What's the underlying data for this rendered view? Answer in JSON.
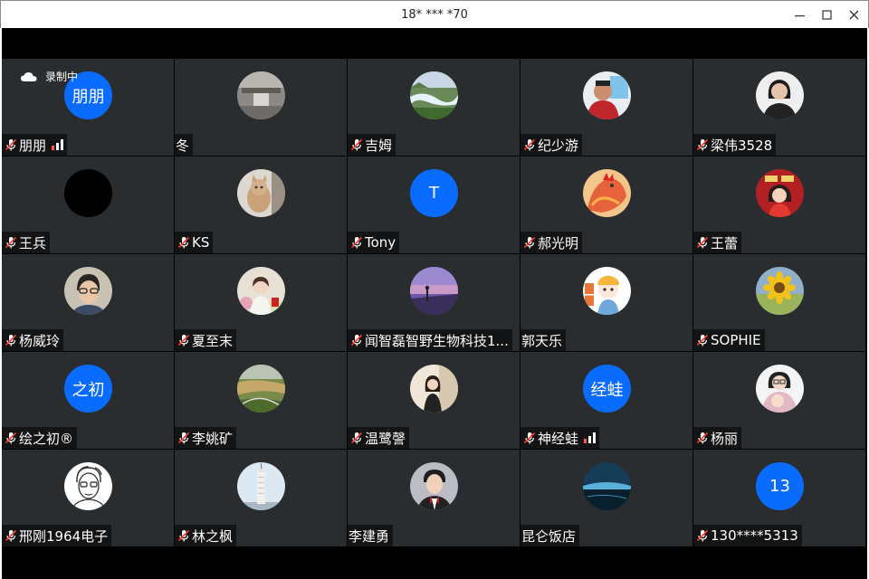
{
  "window": {
    "title": "18* *** *70"
  },
  "recording": {
    "label": "录制中"
  },
  "participants": [
    {
      "name": "朋朋",
      "avatar_text": "朋朋",
      "avatar": "initials",
      "muted": true,
      "signal": true
    },
    {
      "name": "冬",
      "avatar": "photo-courtyard",
      "muted": false
    },
    {
      "name": "吉姆",
      "avatar": "photo-river-landscape",
      "muted": true
    },
    {
      "name": "纪少游",
      "avatar": "photo-man-red-shirt",
      "muted": true
    },
    {
      "name": "梁伟3528",
      "avatar": "photo-woman-portrait",
      "muted": true
    },
    {
      "name": "王兵",
      "avatar": "black-circle",
      "muted": true
    },
    {
      "name": "KS",
      "avatar": "photo-cat",
      "muted": true
    },
    {
      "name": "Tony",
      "avatar_text": "T",
      "avatar": "initials",
      "muted": true
    },
    {
      "name": "郝光明",
      "avatar": "illustration-rooster",
      "muted": true
    },
    {
      "name": "王蕾",
      "avatar": "illustration-red-girl",
      "muted": true
    },
    {
      "name": "杨威玲",
      "avatar": "photo-man-glasses",
      "muted": true
    },
    {
      "name": "夏至末",
      "avatar": "photo-girl-flowers",
      "muted": true
    },
    {
      "name": "闻智磊智野生物科技1...",
      "avatar": "photo-purple-sunset",
      "muted": true
    },
    {
      "name": "郭天乐",
      "avatar": "cartoon-child-cap",
      "muted": false
    },
    {
      "name": "SOPHIE",
      "avatar": "photo-sunflower",
      "muted": true
    },
    {
      "name": "绘之初®",
      "avatar_text": "之初",
      "avatar": "initials",
      "muted": true
    },
    {
      "name": "李姚矿",
      "avatar": "photo-aerial-landscape",
      "muted": true
    },
    {
      "name": "温鹭謦",
      "avatar": "photo-woman-room",
      "muted": true
    },
    {
      "name": "神经蛙",
      "avatar_text": "经蛙",
      "avatar": "initials",
      "muted": true,
      "signal": true
    },
    {
      "name": "杨丽",
      "avatar": "photo-mother-child",
      "muted": true
    },
    {
      "name": "邢刚1964电子",
      "avatar": "sketch-man-glasses",
      "muted": true
    },
    {
      "name": "林之枫",
      "avatar": "photo-tower",
      "muted": true
    },
    {
      "name": "李建勇",
      "avatar": "photo-man-bowtie",
      "muted": false
    },
    {
      "name": "昆仑饭店",
      "avatar": "photo-night-water",
      "muted": false
    },
    {
      "name": "130****5313",
      "avatar_text": "13",
      "avatar": "initials",
      "muted": true
    }
  ],
  "colors": {
    "tile_bg": "#2a2d30",
    "accent_blue": "#0a6cff",
    "mute_red": "#ff3b30"
  }
}
